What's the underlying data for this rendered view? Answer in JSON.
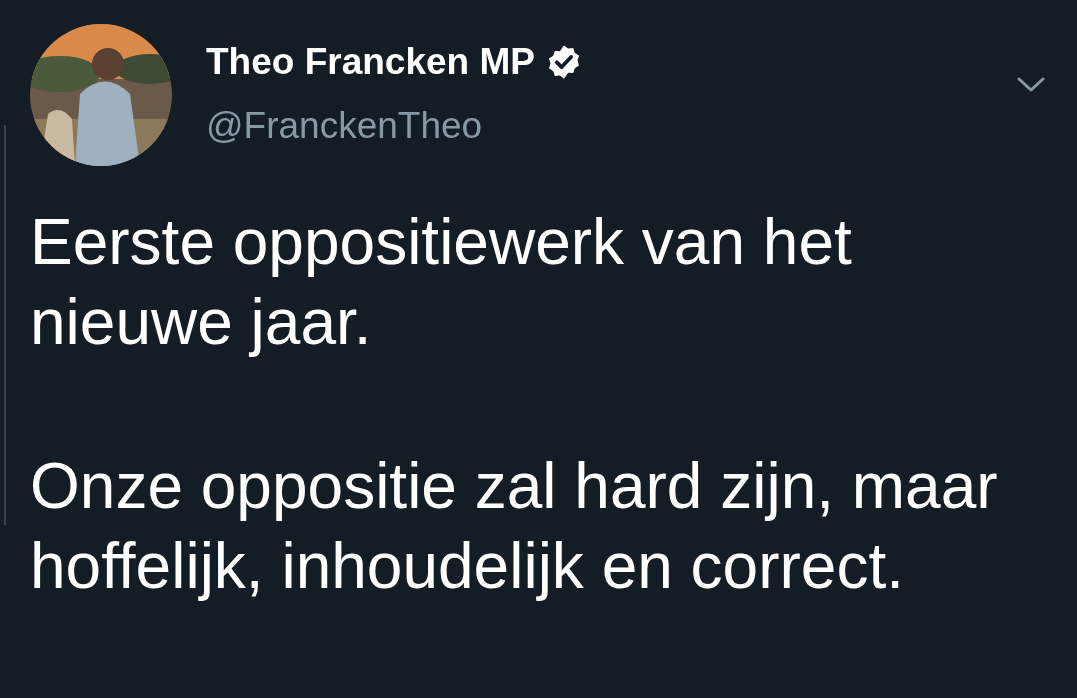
{
  "author": {
    "name": "Theo Francken MP",
    "verified": true,
    "handle": "@FranckenTheo"
  },
  "paragraphs": [
    "Eerste oppositiewerk van het nieuwe jaar.",
    "Onze oppositie zal hard zijn, maar hoffelijk, inhoudelijk en correct."
  ]
}
